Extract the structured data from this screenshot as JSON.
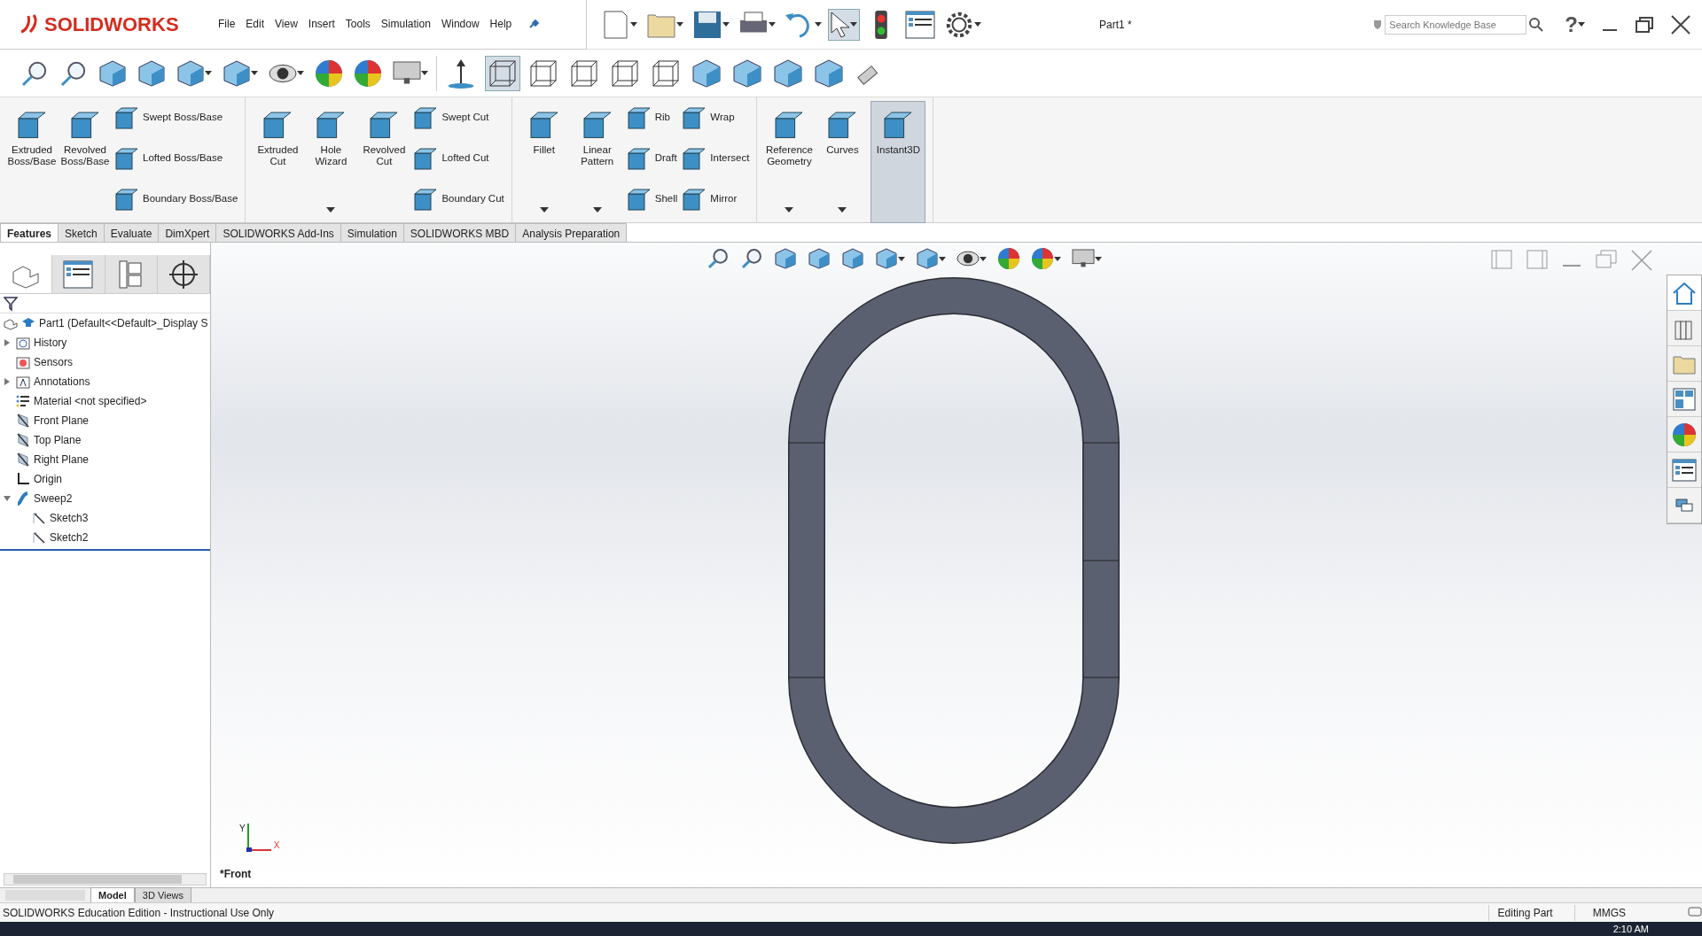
{
  "app": {
    "logo_text": "SOLIDWORKS"
  },
  "menu": [
    "File",
    "Edit",
    "View",
    "Insert",
    "Tools",
    "Simulation",
    "Window",
    "Help"
  ],
  "document_title": "Part1 *",
  "search": {
    "placeholder": "Search Knowledge Base"
  },
  "help": {
    "label": "?"
  },
  "ribbon_groups": [
    {
      "columns": [
        {
          "kind": "large",
          "label": "Extruded Boss/Base",
          "selected": false
        },
        {
          "kind": "large",
          "label": "Revolved Boss/Base",
          "selected": false
        },
        {
          "kind": "stack",
          "items": [
            "Swept Boss/Base",
            "Lofted Boss/Base",
            "Boundary Boss/Base"
          ]
        }
      ]
    },
    {
      "columns": [
        {
          "kind": "large",
          "label": "Extruded Cut",
          "selected": false
        },
        {
          "kind": "large",
          "label": "Hole Wizard",
          "selected": false,
          "dropdown": true
        },
        {
          "kind": "large",
          "label": "Revolved Cut",
          "selected": false
        },
        {
          "kind": "stack",
          "items": [
            "Swept Cut",
            "Lofted Cut",
            "Boundary Cut"
          ]
        }
      ]
    },
    {
      "columns": [
        {
          "kind": "large",
          "label": "Fillet",
          "selected": false,
          "dropdown": true
        },
        {
          "kind": "large",
          "label": "Linear Pattern",
          "selected": false,
          "dropdown": true
        },
        {
          "kind": "stack",
          "items": [
            "Rib",
            "Draft",
            "Shell"
          ]
        },
        {
          "kind": "stack",
          "items": [
            "Wrap",
            "Intersect",
            "Mirror"
          ]
        }
      ]
    },
    {
      "columns": [
        {
          "kind": "large",
          "label": "Reference Geometry",
          "selected": false,
          "dropdown": true
        },
        {
          "kind": "large",
          "label": "Curves",
          "selected": false,
          "dropdown": true
        },
        {
          "kind": "large",
          "label": "Instant3D",
          "selected": true
        }
      ]
    }
  ],
  "tabs": [
    {
      "label": "Features",
      "selected": true
    },
    {
      "label": "Sketch",
      "selected": false
    },
    {
      "label": "Evaluate",
      "selected": false
    },
    {
      "label": "DimXpert",
      "selected": false
    },
    {
      "label": "SOLIDWORKS Add-Ins",
      "selected": false
    },
    {
      "label": "Simulation",
      "selected": false
    },
    {
      "label": "SOLIDWORKS MBD",
      "selected": false
    },
    {
      "label": "Analysis Preparation",
      "selected": false
    }
  ],
  "feature_tree": {
    "root": "Part1  (Default<<Default>_Display S",
    "items": [
      {
        "label": "History",
        "kind": "folder",
        "expanded": false
      },
      {
        "label": "Sensors",
        "kind": "sensor"
      },
      {
        "label": "Annotations",
        "kind": "annotations",
        "expanded": false
      },
      {
        "label": "Material <not specified>",
        "kind": "material"
      },
      {
        "label": "Front Plane",
        "kind": "plane"
      },
      {
        "label": "Top Plane",
        "kind": "plane"
      },
      {
        "label": "Right Plane",
        "kind": "plane"
      },
      {
        "label": "Origin",
        "kind": "origin"
      },
      {
        "label": "Sweep2",
        "kind": "sweep",
        "expanded": true,
        "children": [
          {
            "label": "Sketch3",
            "kind": "sketch"
          },
          {
            "label": "Sketch2",
            "kind": "sketch"
          }
        ]
      }
    ]
  },
  "viewport": {
    "view_name": "*Front",
    "triad": {
      "y_label": "Y",
      "x_label": "X"
    }
  },
  "bottom_tabs": [
    {
      "label": "Model",
      "selected": true
    },
    {
      "label": "3D Views",
      "selected": false
    }
  ],
  "status_bar": {
    "message": "SOLIDWORKS Education Edition - Instructional Use Only",
    "mode": "Editing Part",
    "units": "MMGS"
  },
  "taskbar": {
    "time": "2:10 AM"
  }
}
